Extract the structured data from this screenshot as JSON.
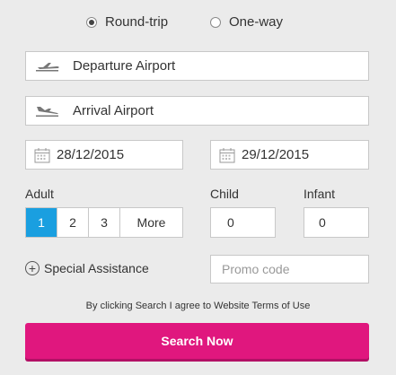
{
  "trip_type": {
    "round_trip_label": "Round-trip",
    "one_way_label": "One-way",
    "selected": "round_trip"
  },
  "departure": {
    "placeholder": "Departure Airport",
    "icon": "departure-plane-icon"
  },
  "arrival": {
    "placeholder": "Arrival Airport",
    "icon": "arrival-plane-icon"
  },
  "dates": {
    "depart_date": "28/12/2015",
    "return_date": "29/12/2015",
    "icon": "calendar-icon"
  },
  "passengers": {
    "adult_label": "Adult",
    "adult_options": [
      "1",
      "2",
      "3",
      "More"
    ],
    "adult_selected": "1",
    "child_label": "Child",
    "child_value": "0",
    "infant_label": "Infant",
    "infant_value": "0"
  },
  "special_assistance": {
    "label": "Special Assistance",
    "icon": "plus-circle-icon"
  },
  "promo": {
    "placeholder": "Promo code"
  },
  "terms_text": "By clicking Search I agree to Website Terms of Use",
  "search_button": {
    "label": "Search Now"
  },
  "colors": {
    "accent_blue": "#1a9fe0",
    "search_pink": "#e0177e",
    "background": "#ebebeb"
  }
}
